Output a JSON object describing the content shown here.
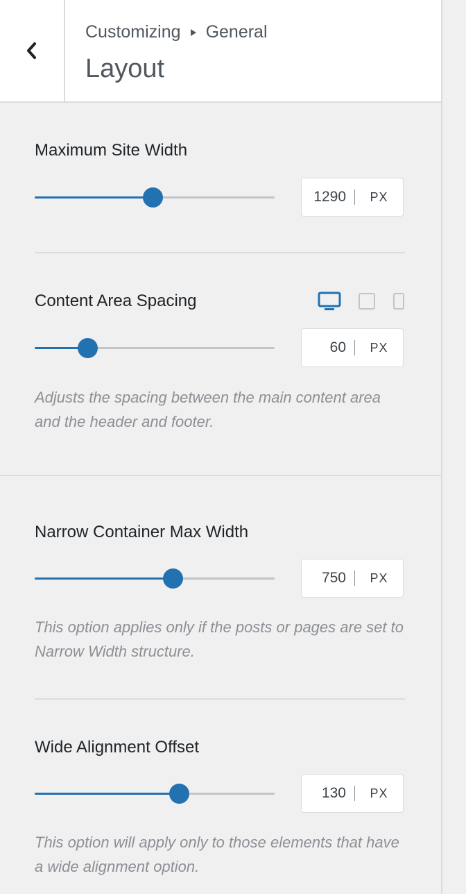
{
  "header": {
    "breadcrumb_root": "Customizing",
    "breadcrumb_current": "General",
    "title": "Layout"
  },
  "controls": {
    "max_site_width": {
      "label": "Maximum Site Width",
      "value": "1290",
      "unit": "PX",
      "fraction": 0.49
    },
    "content_spacing": {
      "label": "Content Area Spacing",
      "value": "60",
      "unit": "PX",
      "fraction": 0.22,
      "description": "Adjusts the spacing between the main content area and the header and footer.",
      "devices": [
        "desktop-icon",
        "tablet-icon",
        "mobile-icon"
      ],
      "active_device": "desktop"
    },
    "narrow_width": {
      "label": "Narrow Container Max Width",
      "value": "750",
      "unit": "PX",
      "fraction": 0.575,
      "description": "This option applies only if the posts or pages are set to Narrow Width structure."
    },
    "wide_offset": {
      "label": "Wide Alignment Offset",
      "value": "130",
      "unit": "PX",
      "fraction": 0.6,
      "description": "This option will apply only to those elements that have a wide alignment option."
    }
  },
  "colors": {
    "accent": "#2271b1",
    "track": "#c3c4c7",
    "background": "#f0f0f1"
  }
}
